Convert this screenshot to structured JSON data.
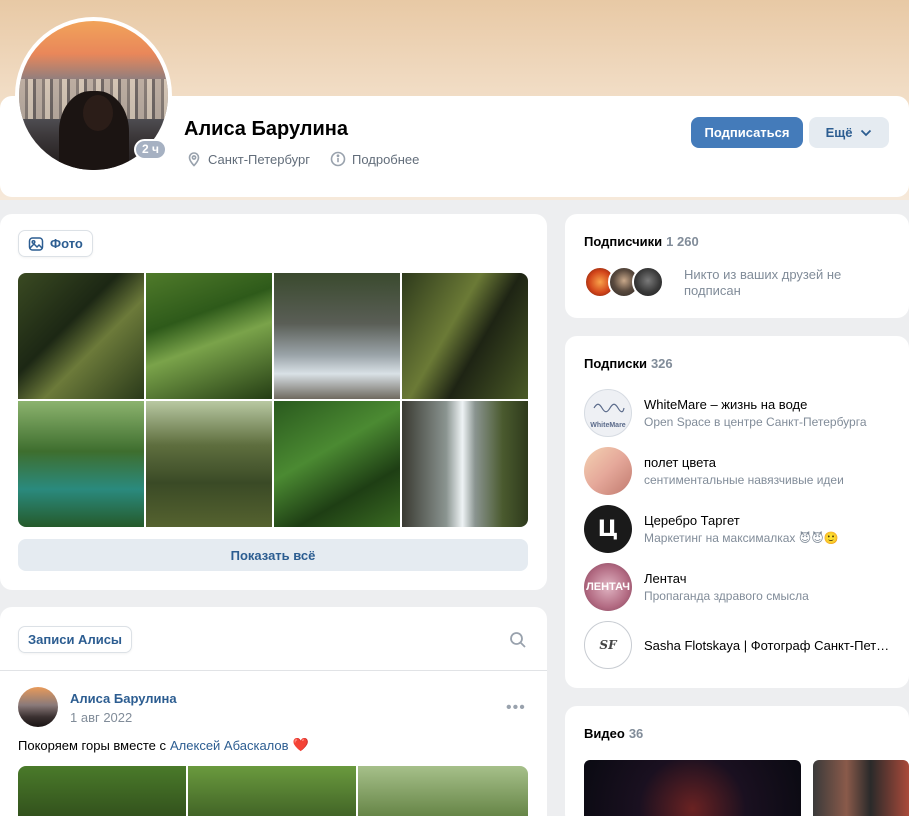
{
  "profile": {
    "name": "Алиса Барулина",
    "online": "2 ч",
    "city": "Санкт-Петербург",
    "details": "Подробнее",
    "subscribe_label": "Подписаться",
    "more_label": "Ещё"
  },
  "photos": {
    "tab_label": "Фото",
    "show_all": "Показать всё"
  },
  "posts": {
    "tab_label": "Записи Алисы",
    "items": [
      {
        "author": "Алиса Барулина",
        "date": "1 авг 2022",
        "text": "Покоряем горы вместе с",
        "mention": "Алексей Абаскалов",
        "emoji": "❤️"
      }
    ]
  },
  "subscribers": {
    "title": "Подписчики",
    "count": "1 260",
    "note": "Никто из ваших друзей не подписан"
  },
  "follows": {
    "title": "Подписки",
    "count": "326",
    "items": [
      {
        "name": "WhiteMare – жизнь на воде",
        "desc": "Open Space в центре Санкт-Петербурга",
        "logo": "WhiteMare"
      },
      {
        "name": "полет цвета",
        "desc": "сентиментальные навязчивые идеи",
        "logo": ""
      },
      {
        "name": "Церебро Таргет",
        "desc": "Маркетинг на максималках 😈😈🙂",
        "logo": "Ц"
      },
      {
        "name": "Лентач",
        "desc": "Пропаганда здравого смысла",
        "logo": "ЛЕНТАЧ"
      },
      {
        "name": "Sasha Flotskaya | Фотограф Санкт-Петербург",
        "desc": "",
        "logo": "SF"
      }
    ]
  },
  "videos": {
    "title": "Видео",
    "count": "36"
  },
  "colors": {
    "accent": "#447bba",
    "link": "#2c5d91",
    "background": "#edeef0"
  }
}
